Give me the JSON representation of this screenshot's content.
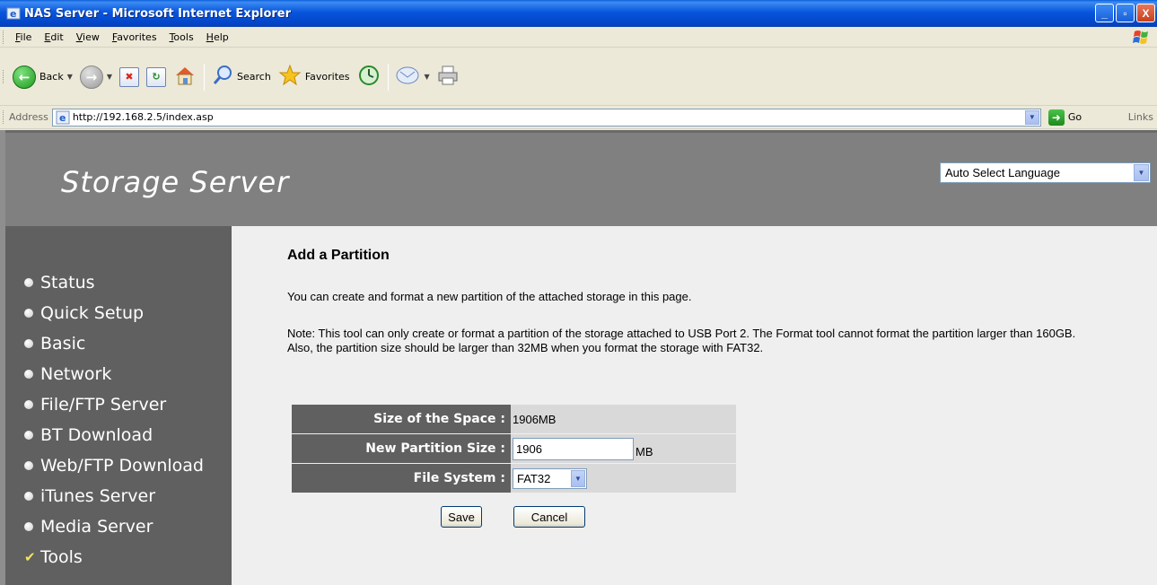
{
  "window": {
    "title": "NAS Server - Microsoft Internet Explorer",
    "buttons": [
      "_",
      "▫",
      "X"
    ]
  },
  "menubar": {
    "items": [
      "File",
      "Edit",
      "View",
      "Favorites",
      "Tools",
      "Help"
    ]
  },
  "toolbar": {
    "back_label": "Back",
    "search_label": "Search",
    "favorites_label": "Favorites"
  },
  "addressbar": {
    "label": "Address",
    "url": "http://192.168.2.5/index.asp",
    "go_label": "Go",
    "links_label": "Links"
  },
  "header": {
    "brand": "Storage Server",
    "language": "Auto Select Language"
  },
  "sidebar": {
    "items": [
      {
        "label": "Status"
      },
      {
        "label": "Quick Setup"
      },
      {
        "label": "Basic"
      },
      {
        "label": "Network"
      },
      {
        "label": "File/FTP Server"
      },
      {
        "label": "BT Download"
      },
      {
        "label": "Web/FTP Download"
      },
      {
        "label": "iTunes Server"
      },
      {
        "label": "Media Server"
      },
      {
        "label": "Tools"
      }
    ],
    "active": "Tools"
  },
  "content": {
    "title": "Add a Partition",
    "intro": "You can create and format a new partition of the attached storage in this page.",
    "note": "Note: This tool can only create or format a partition of the storage attached to USB Port 2. The Format tool cannot format the partition larger than 160GB. Also, the partition size should be larger than 32MB when you format the storage with FAT32.",
    "form": {
      "space_label": "Size of the Space :",
      "space_value": "1906MB",
      "partition_label": "New Partition Size :",
      "partition_value": "1906",
      "partition_unit": "MB",
      "fs_label": "File System :",
      "fs_value": "FAT32"
    },
    "buttons": {
      "save": "Save",
      "cancel": "Cancel"
    }
  }
}
